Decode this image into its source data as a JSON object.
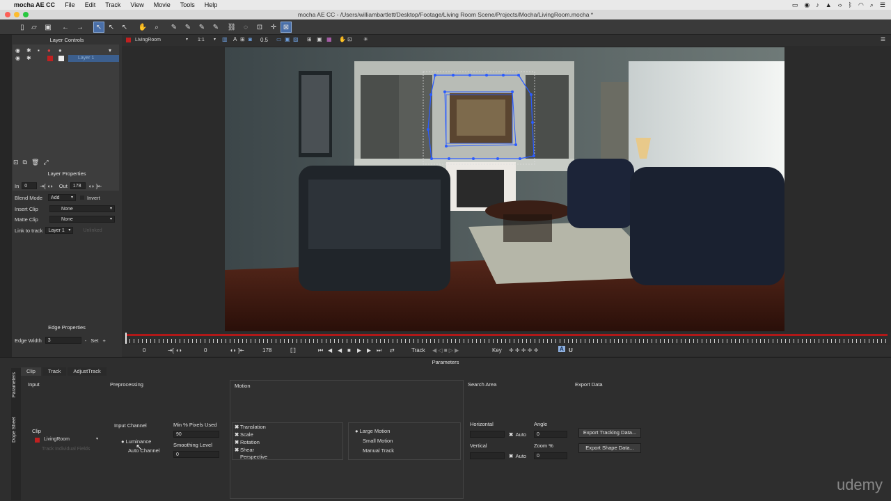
{
  "menubar": {
    "app": "mocha AE CC",
    "items": [
      "File",
      "Edit",
      "Track",
      "View",
      "Movie",
      "Tools",
      "Help"
    ]
  },
  "window": {
    "title": "mocha AE CC - /Users/williambartlett/Desktop/Footage/Living Room Scene/Projects/Mocha/LivingRoom.mocha *"
  },
  "viewer_bar": {
    "clip": "LivingRoom",
    "zoom": "1:1",
    "opacity": "0.5"
  },
  "layer_controls": {
    "title": "Layer Controls",
    "layer_name": "Layer 1"
  },
  "layer_properties": {
    "title": "Layer Properties",
    "in_label": "In",
    "in_value": "0",
    "out_label": "Out",
    "out_value": "178",
    "blend_label": "Blend Mode",
    "blend_value": "Add",
    "invert_label": "Invert",
    "insert_label": "Insert Clip",
    "insert_value": "None",
    "matte_label": "Matte Clip",
    "matte_value": "None",
    "link_label": "Link to track",
    "link_value": "Layer 1",
    "link_extra": "Unlinked"
  },
  "edge_properties": {
    "title": "Edge Properties",
    "label": "Edge Width",
    "value": "3",
    "set_label": "Set"
  },
  "transport": {
    "start": "0",
    "current": "0",
    "end": "178",
    "track_label": "Track",
    "key_label": "Key"
  },
  "parameters": {
    "title": "Parameters",
    "side_tabs": [
      "Parameters",
      "Dope Sheet"
    ],
    "tabs": [
      "Clip",
      "Track",
      "AdjustTrack"
    ],
    "input": {
      "title": "Input",
      "clip_label": "Clip",
      "clip_value": "LivingRoom",
      "track_individual": "Track Individual Fields"
    },
    "preprocessing": {
      "title": "Preprocessing",
      "channel_label": "Input Channel",
      "luminance": "Luminance",
      "auto_channel": "Auto Channel",
      "min_pixels_label": "Min % Pixels Used",
      "min_pixels_value": "90",
      "smoothing_label": "Smoothing Level",
      "smoothing_value": "0"
    },
    "motion": {
      "title": "Motion",
      "options": [
        "Translation",
        "Scale",
        "Rotation",
        "Shear",
        "Perspective"
      ],
      "checked": [
        true,
        true,
        true,
        true,
        false
      ],
      "modes": [
        "Large Motion",
        "Small Motion",
        "Manual Track"
      ]
    },
    "search_area": {
      "title": "Search Area",
      "horizontal_label": "Horizontal",
      "vertical_label": "Vertical",
      "auto_label": "Auto",
      "angle_label": "Angle",
      "angle_value": "0",
      "zoom_label": "Zoom %",
      "zoom_value": "0"
    },
    "export": {
      "title": "Export Data",
      "tracking_button": "Export Tracking Data...",
      "shape_button": "Export Shape Data..."
    }
  },
  "watermark": "udemy"
}
